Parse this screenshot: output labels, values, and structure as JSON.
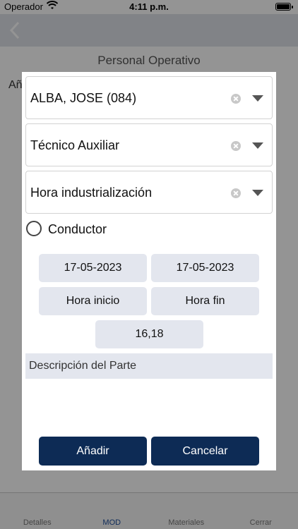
{
  "status_bar": {
    "carrier": "Operador",
    "time": "4:11 p.m."
  },
  "page": {
    "title": "Personal Operativo",
    "year_label": "Añ"
  },
  "tabs": [
    {
      "label": "Detalles"
    },
    {
      "label": "MOD"
    },
    {
      "label": "Materiales"
    },
    {
      "label": "Cerrar"
    }
  ],
  "dialog": {
    "employee_select": {
      "value": "ALBA, JOSE (084)"
    },
    "category_select": {
      "value": "Técnico Auxiliar"
    },
    "hour_type_select": {
      "value": "Hora industrialización"
    },
    "driver_radio": {
      "label": "Conductor",
      "checked": false
    },
    "start_date": "17-05-2023",
    "end_date": "17-05-2023",
    "start_time_label": "Hora inicio",
    "end_time_label": "Hora fin",
    "hours_value": "16,18",
    "description_label": "Descripción del Parte",
    "add_label": "Añadir",
    "cancel_label": "Cancelar"
  },
  "colors": {
    "primary_button": "#0d2b55",
    "field_background": "#e3e6ee"
  }
}
